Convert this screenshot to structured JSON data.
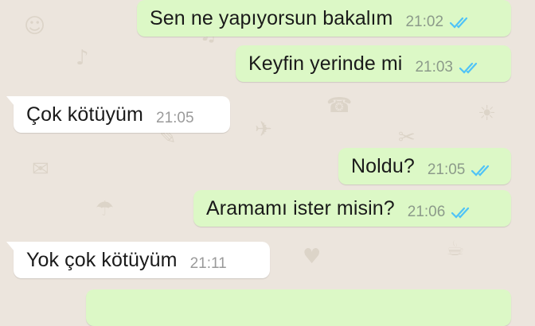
{
  "chat": {
    "messages": [
      {
        "text": "Sen ne yapıyorsun bakalım",
        "time": "21:02",
        "direction": "outgoing",
        "status": "read"
      },
      {
        "text": "Keyfin yerinde mi",
        "time": "21:03",
        "direction": "outgoing",
        "status": "read"
      },
      {
        "text": "Çok kötüyüm",
        "time": "21:05",
        "direction": "incoming"
      },
      {
        "text": "Noldu?",
        "time": "21:05",
        "direction": "outgoing",
        "status": "read"
      },
      {
        "text": "Aramamı ister misin?",
        "time": "21:06",
        "direction": "outgoing",
        "status": "read"
      },
      {
        "text": "Yok çok kötüyüm",
        "time": "21:11",
        "direction": "incoming"
      },
      {
        "text": "",
        "time": "",
        "direction": "outgoing",
        "status": "partially-visible"
      }
    ]
  },
  "colors": {
    "background": "#ece5dd",
    "outgoing_bubble": "#dcf8c6",
    "incoming_bubble": "#ffffff",
    "read_ticks": "#4fc3f7"
  },
  "icons": {
    "read_receipt": "double-check-icon"
  }
}
